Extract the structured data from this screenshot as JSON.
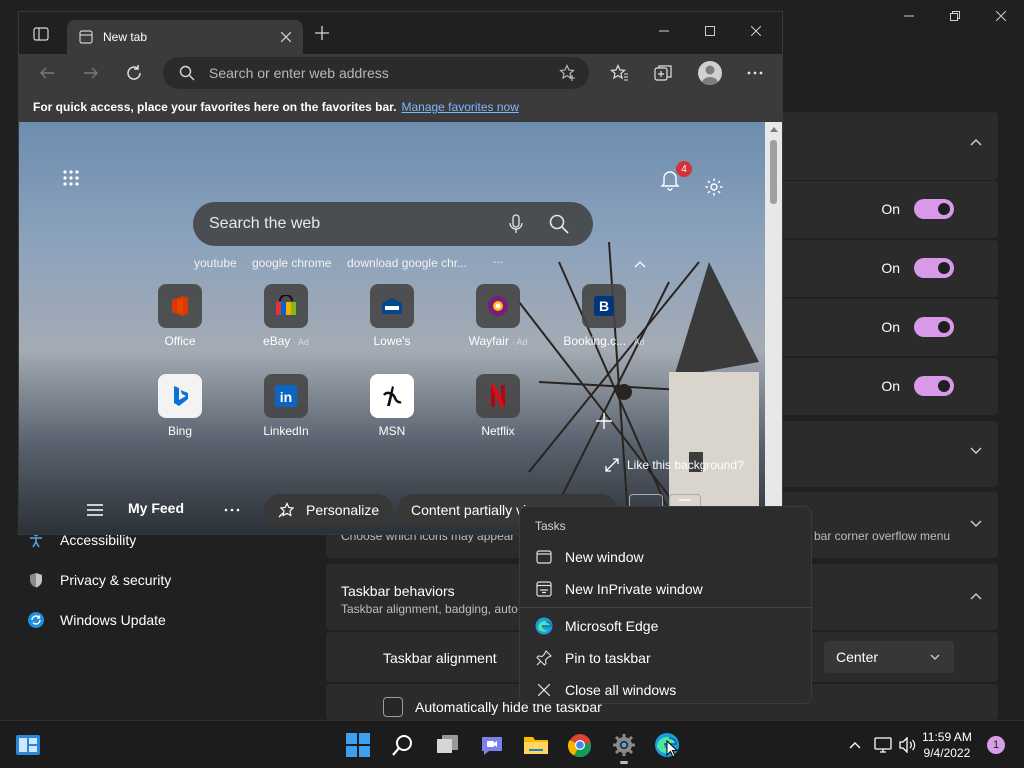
{
  "settings": {
    "toggle_rows": [
      {
        "state": "On"
      },
      {
        "state": "On"
      },
      {
        "state": "On"
      },
      {
        "state": "On"
      }
    ],
    "nav": [
      {
        "label": "Accessibility",
        "icon": "accessibility-icon"
      },
      {
        "label": "Privacy & security",
        "icon": "shield-icon"
      },
      {
        "label": "Windows Update",
        "icon": "windows-update-icon"
      }
    ],
    "overflow_section": {
      "description_left": "Choose which icons may appear",
      "description_right": "bar corner overflow menu"
    },
    "taskbar_behaviors": {
      "title": "Taskbar behaviors",
      "description": "Taskbar alignment, badging, auto"
    },
    "taskbar_alignment": {
      "label": "Taskbar alignment",
      "value": "Center"
    },
    "auto_hide": {
      "label": "Automatically hide the taskbar",
      "checked": false
    }
  },
  "edge": {
    "tab_title": "New tab",
    "address_placeholder": "Search or enter web address",
    "favbar_text": "For quick access, place your favorites here on the favorites bar.",
    "favbar_link": "Manage favorites now",
    "notification_count": "4",
    "search_placeholder": "Search the web",
    "suggestions": [
      "youtube",
      "google chrome",
      "download google chr...",
      "..."
    ],
    "tiles_row1": [
      {
        "label": "Office",
        "ad": "",
        "icon": "office-icon",
        "color": "#d83b01"
      },
      {
        "label": "eBay",
        "ad": "Ad",
        "icon": "ebay-icon",
        "color": "#e53238"
      },
      {
        "label": "Lowe's",
        "ad": "",
        "icon": "lowes-icon",
        "color": "#004990"
      },
      {
        "label": "Wayfair",
        "ad": "Ad",
        "icon": "wayfair-icon",
        "color": "#7f187f"
      },
      {
        "label": "Booking.c...",
        "ad": "Ad",
        "icon": "booking-icon",
        "color": "#003580"
      }
    ],
    "tiles_row2": [
      {
        "label": "Bing",
        "ad": "",
        "icon": "bing-icon",
        "color": "#ffffff"
      },
      {
        "label": "LinkedIn",
        "ad": "",
        "icon": "linkedin-icon",
        "color": "#0a66c2"
      },
      {
        "label": "MSN",
        "ad": "",
        "icon": "msn-icon",
        "color": "#ffffff"
      },
      {
        "label": "Netflix",
        "ad": "",
        "icon": "netflix-icon",
        "color": "#e50914"
      }
    ],
    "like_background": "Like this background?",
    "feed": {
      "my_feed": "My Feed",
      "personalize": "Personalize",
      "content_visible": "Content partially vi"
    }
  },
  "jumplist": {
    "header": "Tasks",
    "items": [
      {
        "label": "New window",
        "icon": "window-icon"
      },
      {
        "label": "New InPrivate window",
        "icon": "inprivate-window-icon"
      },
      {
        "label": "Microsoft Edge",
        "icon": "edge-icon"
      },
      {
        "label": "Pin to taskbar",
        "icon": "pin-icon"
      },
      {
        "label": "Close all windows",
        "icon": "close-icon"
      }
    ]
  },
  "taskbar": {
    "time": "11:59 AM",
    "date": "9/4/2022",
    "notification_count": "1",
    "apps": [
      "start-icon",
      "search-icon",
      "task-view-icon",
      "chat-icon",
      "file-explorer-icon",
      "chrome-icon",
      "settings-icon",
      "edge-icon"
    ]
  },
  "colors": {
    "accent": "#d89ae8",
    "settings_bg": "#202020",
    "card_bg": "#2b2b2b"
  }
}
